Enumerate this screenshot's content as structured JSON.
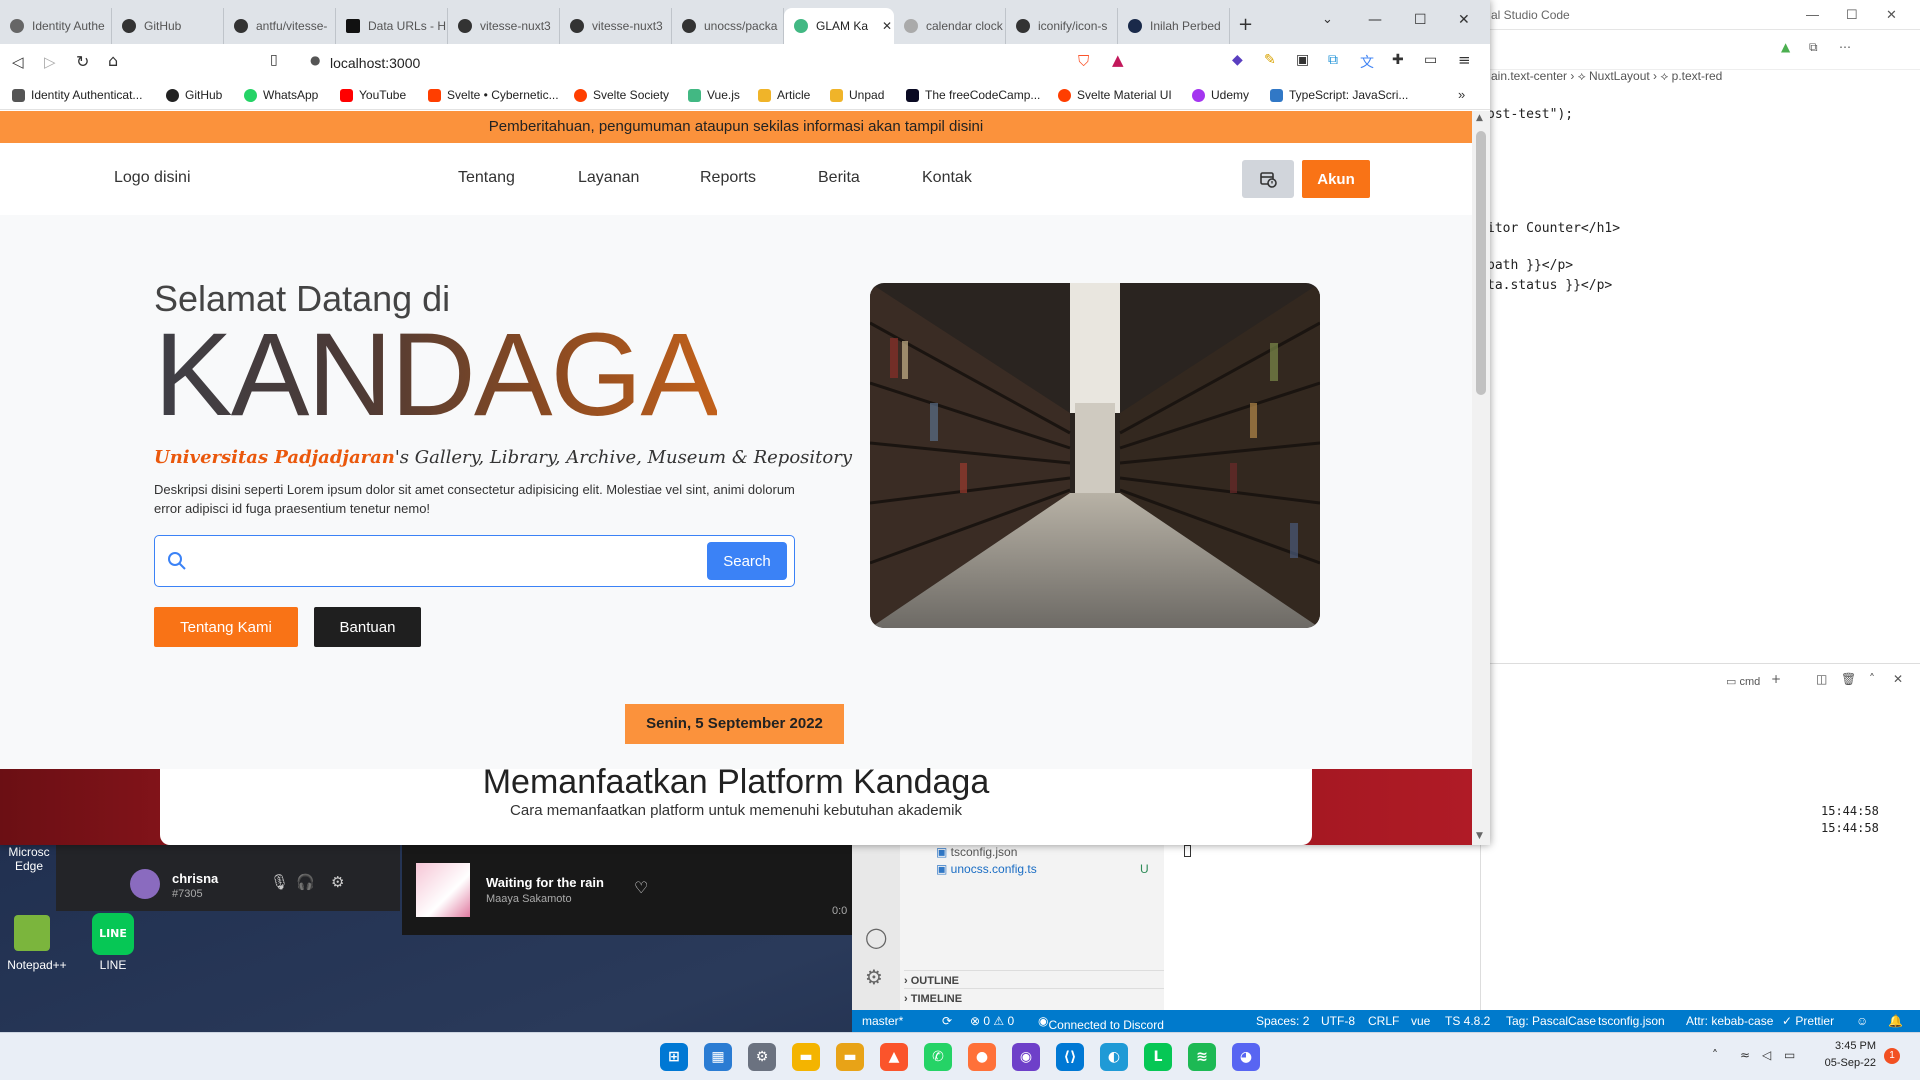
{
  "vscode": {
    "title": "al Studio Code",
    "breadcrumb": [
      "ain.text-center",
      "NuxtLayout",
      "p.text-red"
    ],
    "code_lines": [
      {
        "text": "ost-test\");"
      },
      {
        "text": "itor Counter</h1>"
      },
      {
        "text": "path }}</p>"
      },
      {
        "text": "ta.status }}</p>"
      }
    ],
    "terminal_label": "cmd",
    "terminal_times": [
      "15:44:58",
      "15:44:58"
    ],
    "explorer_files": [
      "tsconfig.json",
      "unocss.config.ts"
    ],
    "explorer_file_status": "U",
    "sections": [
      "OUTLINE",
      "TIMELINE"
    ]
  },
  "statusbar": {
    "branch": "master*",
    "problems": "⊗ 0 ⚠ 0",
    "discord": "Connected to Discord",
    "spaces": "Spaces: 2",
    "encoding": "UTF-8",
    "eol": "CRLF",
    "lang": "vue",
    "ts": "TS 4.8.2",
    "tag": "Tag: PascalCase",
    "tsconfig": "tsconfig.json",
    "attr": "Attr: kebab-case",
    "prettier": "✓ Prettier"
  },
  "discord": {
    "user": "chrisna",
    "tag": "#7305"
  },
  "spotify": {
    "track": "Waiting for the rain",
    "artist": "Maaya Sakamoto",
    "time": "0:0"
  },
  "desktop_icons": [
    "Microsc Edge",
    "Notepad++",
    "LINE"
  ],
  "taskbar": {
    "time": "3:45 PM",
    "date": "05-Sep-22",
    "notifications": "1"
  },
  "browser": {
    "tabs": [
      {
        "label": "Identity Authe"
      },
      {
        "label": "GitHub"
      },
      {
        "label": "antfu/vitesse-"
      },
      {
        "label": "Data URLs - H"
      },
      {
        "label": "vitesse-nuxt3"
      },
      {
        "label": "vitesse-nuxt3"
      },
      {
        "label": "unocss/packa"
      },
      {
        "label": "GLAM Ka"
      },
      {
        "label": "calendar clock"
      },
      {
        "label": "iconify/icon-s"
      },
      {
        "label": "Inilah Perbed"
      }
    ],
    "url": "localhost:3000",
    "bookmarks": [
      {
        "label": "Identity Authenticat...",
        "color": "#555555"
      },
      {
        "label": "GitHub",
        "color": "#222222"
      },
      {
        "label": "WhatsApp",
        "color": "#25d366"
      },
      {
        "label": "YouTube",
        "color": "#ff0000"
      },
      {
        "label": "Svelte • Cybernetic...",
        "color": "#ff3e00"
      },
      {
        "label": "Svelte Society",
        "color": "#ff3e00"
      },
      {
        "label": "Vue.js",
        "color": "#42b883"
      },
      {
        "label": "Article",
        "color": "#f0b429"
      },
      {
        "label": "Unpad",
        "color": "#f0b429"
      },
      {
        "label": "The freeCodeCamp...",
        "color": "#0a0a23"
      },
      {
        "label": "Svelte Material UI",
        "color": "#ff3e00"
      },
      {
        "label": "Udemy",
        "color": "#a435f0"
      },
      {
        "label": "TypeScript: JavaScri...",
        "color": "#3178c6"
      }
    ]
  },
  "page": {
    "notice": "Pemberitahuan, pengumuman ataupun sekilas informasi akan tampil disini",
    "logo": "Logo disini",
    "nav": [
      "Tentang",
      "Layanan",
      "Reports",
      "Berita",
      "Kontak"
    ],
    "account_button": "Akun",
    "welcome": "Selamat Datang di",
    "brand": "KANDAGA",
    "tagline_highlight": "Universitas Padjadjaran",
    "tagline_rest": "'s Gallery, Library, Archive, Museum & Repository",
    "description": "Deskripsi disini seperti Lorem ipsum dolor sit amet consectetur adipisicing elit. Molestiae vel sint, animi dolorum error adipisci id fuga praesentium tenetur nemo!",
    "search_placeholder": "",
    "search_button": "Search",
    "about_button": "Tentang Kami",
    "help_button": "Bantuan",
    "date": "Senin, 5 September 2022",
    "promo_title": "Memanfaatkan Platform Kandaga",
    "promo_subtitle": "Cara memanfaatkan platform untuk memenuhi kebutuhan akademik"
  },
  "colors": {
    "accent": "#f97316",
    "primary": "#3b82f6",
    "notice": "#fb923c",
    "dark": "#1f1f1f"
  }
}
